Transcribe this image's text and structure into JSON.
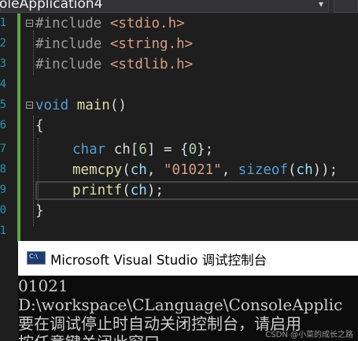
{
  "toolbar": {
    "project_dropdown": "oleApplication4",
    "dropdown_arrow": "▾"
  },
  "editor": {
    "lines": [
      {
        "num": "1",
        "tokens": {
          "pp": "#include ",
          "inc": "<stdio.h>"
        }
      },
      {
        "num": "2",
        "tokens": {
          "pp": "#include ",
          "inc": "<string.h>"
        }
      },
      {
        "num": "3",
        "tokens": {
          "pp": "#include ",
          "inc": "<stdlib.h>"
        }
      },
      {
        "num": "4"
      },
      {
        "num": "5",
        "tokens": {
          "kw": "void",
          "sp": " ",
          "fn": "main",
          "rest": "()"
        }
      },
      {
        "num": "6",
        "tokens": {
          "brace": "{"
        }
      },
      {
        "num": "7",
        "tokens": {
          "kw": "char",
          "sp": " ",
          "var": "ch",
          "a": "[",
          "num": "6",
          "b": "] = {",
          "num2": "0",
          "c": "};"
        }
      },
      {
        "num": "8",
        "tokens": {
          "fn": "memcpy",
          "a": "(",
          "var": "ch",
          "b": ", ",
          "str": "\"01021\"",
          "c": ", ",
          "kw": "sizeof",
          "d": "(",
          "var2": "ch",
          "e": "));"
        }
      },
      {
        "num": "9",
        "tokens": {
          "fn": "printf",
          "a": "(",
          "var": "ch",
          "b": ");"
        }
      },
      {
        "num": "0"
      },
      {
        "num": "1",
        "tokens": {
          "brace": "}"
        }
      },
      {
        "num": "2"
      }
    ]
  },
  "console": {
    "icon_label": "C:\\",
    "title": "Microsoft Visual Studio 调试控制台",
    "output": [
      "01021",
      "D:\\workspace\\CLanguage\\ConsoleApplic",
      "要在调试停止时自动关闭控制台，请启用",
      "按任意键关闭此窗口. . ."
    ],
    "watermark": "CSDN @小菜的成长之路"
  },
  "colors": {
    "editor_bg": "#1e1e1e",
    "keyword": "#569cd6",
    "string": "#d69d85",
    "function": "#dcdcaa",
    "variable": "#9cdcfe",
    "number": "#b5cea8",
    "line_number": "#2b91af",
    "change_bar": "#57a64a"
  }
}
